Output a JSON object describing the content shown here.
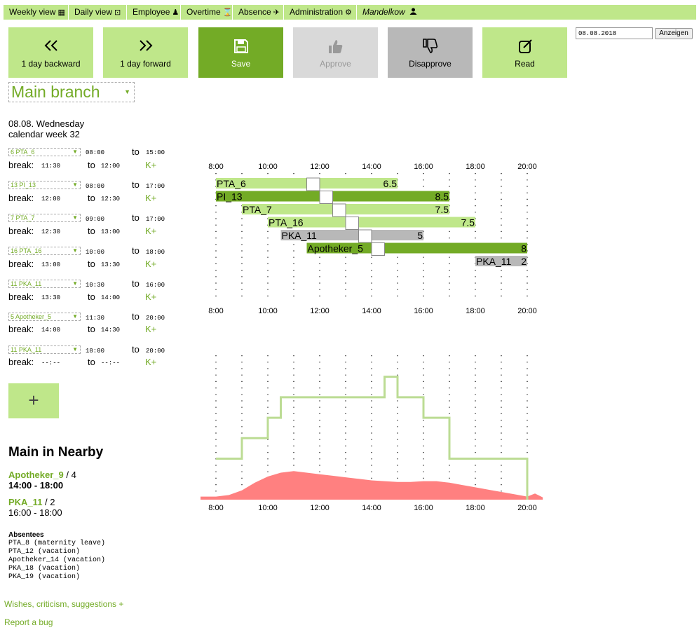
{
  "menu": [
    {
      "label": "Weekly view",
      "icon": "▦"
    },
    {
      "label": "Daily view",
      "icon": "⊡"
    },
    {
      "label": "Employee",
      "icon": "♟"
    },
    {
      "label": "Overtime",
      "icon": "⌛"
    },
    {
      "label": "Absence",
      "icon": "✈"
    },
    {
      "label": "Administration",
      "icon": "⚙"
    },
    {
      "label": "Mandelkow",
      "icon": "👤"
    }
  ],
  "toolbar": {
    "back": "1 day backward",
    "forward": "1 day forward",
    "save": "Save",
    "approve": "Approve",
    "disapprove": "Disapprove",
    "read": "Read"
  },
  "date": {
    "value": "08.08.2018",
    "button": "Anzeigen"
  },
  "branch": "Main branch",
  "day": {
    "line1": "08.08. Wednesday",
    "line2": "calendar week 32"
  },
  "labels": {
    "to": "to",
    "break": "break:",
    "kplus": "K+"
  },
  "shifts": [
    {
      "employee": "6 PTA_6",
      "start": "08:00",
      "end": "15:00",
      "break_start": "11:30",
      "break_end": "12:00"
    },
    {
      "employee": "13 PI_13",
      "start": "08:00",
      "end": "17:00",
      "break_start": "12:00",
      "break_end": "12:30"
    },
    {
      "employee": "7 PTA_7",
      "start": "09:00",
      "end": "17:00",
      "break_start": "12:30",
      "break_end": "13:00"
    },
    {
      "employee": "16 PTA_16",
      "start": "10:00",
      "end": "18:00",
      "break_start": "13:00",
      "break_end": "13:30"
    },
    {
      "employee": "11 PKA_11",
      "start": "10:30",
      "end": "16:00",
      "break_start": "13:30",
      "break_end": "14:00"
    },
    {
      "employee": "5 Apotheker_5",
      "start": "11:30",
      "end": "20:00",
      "break_start": "14:00",
      "break_end": "14:30"
    },
    {
      "employee": "11 PKA_11",
      "start": "18:00",
      "end": "20:00",
      "break_start": "--:--",
      "break_end": "--:--"
    }
  ],
  "add_button": "+",
  "nearby": {
    "title": "Main in Nearby",
    "entries": [
      {
        "name": "Apotheker_9",
        "count": "/ 4",
        "time": "14:00 - 18:00"
      },
      {
        "name": "PKA_11",
        "count": "/ 2",
        "time": "16:00 - 18:00"
      }
    ]
  },
  "absentees": {
    "title": "Absentees",
    "items": [
      "PTA_8 (maternity leave)",
      "PTA_12 (vacation)",
      "Apotheker_14 (vacation)",
      "PKA_18 (vacation)",
      "PKA_19 (vacation)"
    ]
  },
  "footer": {
    "wishes": "Wishes, criticism, suggestions +",
    "bug": "Report a bug"
  },
  "chart_data": {
    "type": "gantt",
    "hour_ticks": [
      "8:00",
      "10:00",
      "12:00",
      "14:00",
      "16:00",
      "18:00",
      "20:00"
    ],
    "x_range": [
      8,
      20
    ],
    "colors": {
      "light": "#bfe78a",
      "dark": "#73ab26",
      "gray": "#b8b8b8",
      "red": "#ff8080",
      "staff_line": "#bcdc94"
    },
    "bars": [
      {
        "label": "PTA_6",
        "hours": "6.5",
        "start": 8.0,
        "end": 15.0,
        "break": 11.5,
        "color": "light"
      },
      {
        "label": "PI_13",
        "hours": "8.5",
        "start": 8.0,
        "end": 17.0,
        "break": 12.0,
        "color": "dark"
      },
      {
        "label": "PTA_7",
        "hours": "7.5",
        "start": 9.0,
        "end": 17.0,
        "break": 12.5,
        "color": "light"
      },
      {
        "label": "PTA_16",
        "hours": "7.5",
        "start": 10.0,
        "end": 18.0,
        "break": 13.0,
        "color": "light"
      },
      {
        "label": "PKA_11",
        "hours": "5",
        "start": 10.5,
        "end": 16.0,
        "break": 13.5,
        "color": "gray"
      },
      {
        "label": "Apotheker_5",
        "hours": "8",
        "start": 11.5,
        "end": 20.0,
        "break": 14.0,
        "color": "dark"
      },
      {
        "label": "PKA_11",
        "hours": "2",
        "start": 18.0,
        "end": 20.0,
        "break": null,
        "color": "gray"
      }
    ],
    "staffing": [
      [
        8.0,
        2
      ],
      [
        9.0,
        3
      ],
      [
        10.0,
        4
      ],
      [
        10.5,
        5
      ],
      [
        11.5,
        5
      ],
      [
        14.5,
        6
      ],
      [
        15.0,
        5
      ],
      [
        16.0,
        4
      ],
      [
        17.0,
        2
      ],
      [
        20.0,
        2
      ]
    ],
    "staffing_max": 6.5,
    "demand": [
      [
        8.0,
        0.2
      ],
      [
        8.5,
        0.3
      ],
      [
        9.0,
        0.6
      ],
      [
        9.5,
        1.1
      ],
      [
        10.0,
        1.5
      ],
      [
        10.5,
        1.75
      ],
      [
        11.0,
        1.85
      ],
      [
        11.5,
        1.75
      ],
      [
        12.0,
        1.65
      ],
      [
        12.5,
        1.55
      ],
      [
        13.0,
        1.45
      ],
      [
        13.5,
        1.35
      ],
      [
        14.0,
        1.25
      ],
      [
        14.5,
        1.2
      ],
      [
        15.0,
        1.15
      ],
      [
        15.5,
        1.15
      ],
      [
        16.0,
        1.2
      ],
      [
        16.5,
        1.2
      ],
      [
        17.0,
        1.1
      ],
      [
        17.5,
        0.95
      ],
      [
        18.0,
        0.8
      ],
      [
        18.5,
        0.65
      ],
      [
        19.0,
        0.5
      ],
      [
        19.5,
        0.35
      ],
      [
        20.0,
        0.2
      ],
      [
        20.3,
        0.4
      ],
      [
        20.6,
        0.15
      ]
    ]
  }
}
